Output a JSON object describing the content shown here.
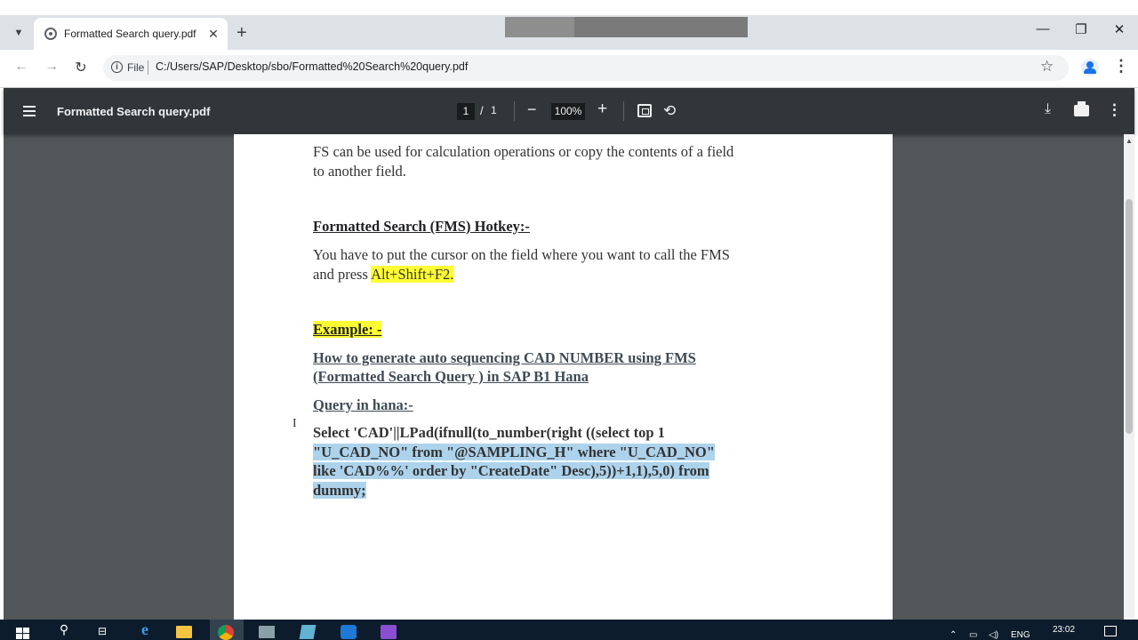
{
  "browser": {
    "tab_title": "Formatted Search query.pdf",
    "tab_close": "✕",
    "new_tab": "+",
    "window_controls": {
      "minimize": "—",
      "restore": "❐",
      "close": "✕"
    },
    "nav": {
      "back": "←",
      "forward": "→",
      "reload": "↻"
    },
    "site_info_label": "File",
    "url": "C:/Users/SAP/Desktop/sbo/Formatted%20Search%20query.pdf",
    "bookmark_icon": "☆",
    "menu_icon": "⋮"
  },
  "pdf_toolbar": {
    "title": "Formatted Search query.pdf",
    "current_page": "1",
    "page_separator": "/",
    "total_pages": "1",
    "zoom_out": "−",
    "zoom": "100%",
    "zoom_in": "+",
    "rotate_icon": "⟲",
    "download_icon": "⤓",
    "more_icon": "⋮"
  },
  "document": {
    "intro_line1": "FS can be used for calculation operations or copy the contents of a field",
    "intro_line2": "to another field.",
    "hotkey_heading": "Formatted Search (FMS) Hotkey:-",
    "hotkey_line1": "You have to put the cursor on the field where you want to call the FMS",
    "hotkey_line2_prefix": "and press ",
    "hotkey_keys": "Alt+Shift+F2.",
    "example_heading": "Example: -",
    "howto_line1": "How to generate auto sequencing CAD NUMBER using FMS",
    "howto_line2": "(Formatted Search Query ) in SAP B1 Hana",
    "query_heading": "Query in hana:-",
    "query_line1": "Select 'CAD'||LPad(ifnull(to_number(right ((select top 1",
    "query_line2": "\"U_CAD_NO\" from \"@SAMPLING_H\" where \"U_CAD_NO\"",
    "query_line3": "like 'CAD%%' order by \"CreateDate\" Desc),5))+1,1),5,0) from",
    "query_line4": "dummy;"
  },
  "taskbar": {
    "search_icon": "⚲",
    "lang": "ENG",
    "time": "23:02",
    "apps": [
      "task-view-icon",
      "edge-icon",
      "file-explorer-icon",
      "chrome-icon",
      "sap-icon",
      "notepad-icon",
      "outlook-icon",
      "visual-studio-icon"
    ]
  }
}
